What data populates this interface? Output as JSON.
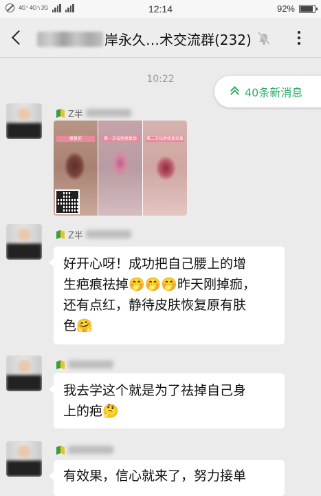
{
  "status_bar": {
    "network": "4G⁺ 4G⁺ₗ 2G",
    "time": "12:14",
    "battery_percent": "92%",
    "battery_level": 0.92
  },
  "header": {
    "title": "…术交流群(232)",
    "title_prefix_visible": "岸永久",
    "back_icon": "back-arrow-icon",
    "mute_icon": "bell-mute-icon",
    "more_icon": "more-dots-icon"
  },
  "chat": {
    "timestamp": "10:22",
    "new_messages_label": "40条新消息",
    "messages": [
      {
        "sender_prefix": "Z半",
        "type": "image",
        "image_labels": [
          "修复前",
          "第一次祛疤修复后",
          "第二次祛疤修复效果"
        ]
      },
      {
        "sender_prefix": "Z半",
        "type": "text",
        "text_line_1": "好开心呀！成功把自己腰上的增",
        "text_line_2": "生疤痕祛掉",
        "emoji_line_2": "🤭🤭🤭",
        "text_line_2b": "昨天刚掉痂，",
        "text_line_3": "还有点红，静待皮肤恢复原有肤",
        "text_line_4": "色",
        "emoji_line_4": "🤗"
      },
      {
        "sender_prefix": "",
        "type": "text",
        "text_line_1": "我去学这个就是为了祛掉自己身",
        "text_line_2": "上的疤",
        "emoji_line_2": "🤔"
      },
      {
        "sender_prefix": "",
        "type": "text",
        "text_line_1": "有效果，信心就来了，努力接单"
      }
    ]
  },
  "colors": {
    "accent_green": "#2aae67",
    "chat_background": "#ebebeb",
    "bubble_white": "#ffffff"
  }
}
